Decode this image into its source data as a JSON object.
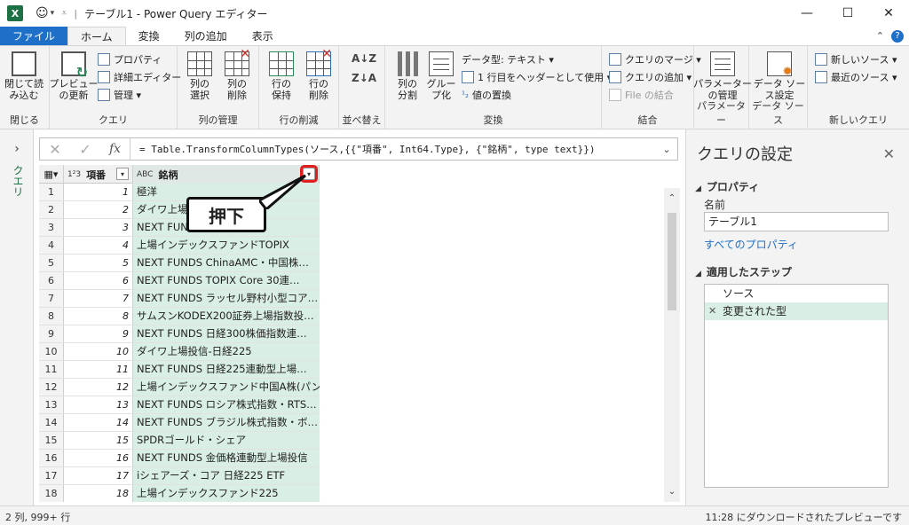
{
  "window": {
    "title": "テーブル1 - Power Query エディター",
    "app_icon": "X",
    "quick_access_icon": "smiley-icon"
  },
  "tabs": [
    {
      "label": "ファイル"
    },
    {
      "label": "ホーム"
    },
    {
      "label": "変換"
    },
    {
      "label": "列の追加"
    },
    {
      "label": "表示"
    }
  ],
  "ribbon": {
    "close": {
      "btn": "閉じて読\nみ込む",
      "group": "閉じる"
    },
    "query": {
      "preview": "プレビュー\nの更新",
      "properties": "プロパティ",
      "advanced_editor": "詳細エディター",
      "manage": "管理",
      "group": "クエリ"
    },
    "columns": {
      "choose": "列の\n選択",
      "remove": "列の\n削除",
      "group": "列の管理"
    },
    "rows": {
      "keep": "行の\n保持",
      "remove": "行の\n削除",
      "group": "行の削減"
    },
    "sort": {
      "group": "並べ替え",
      "az": "A↓Z",
      "za": "Z↓A"
    },
    "transform": {
      "split": "列の\n分割",
      "group_by": "グルー\nプ化",
      "data_type": "データ型: テキスト",
      "header": "1 行目をヘッダーとして使用",
      "replace": "値の置換",
      "group": "変換"
    },
    "combine": {
      "merge": "クエリのマージ",
      "append": "クエリの追加",
      "file_combine": "File の結合",
      "group": "結合"
    },
    "params": {
      "manage": "パラメーター\nの管理",
      "group": "パラメーター"
    },
    "datasource": {
      "settings": "データ ソー\nス設定",
      "group": "データ ソース"
    },
    "newquery": {
      "new_source": "新しいソース",
      "recent": "最近のソース",
      "group": "新しいクエリ"
    }
  },
  "left_pane": {
    "label": "クエリ"
  },
  "formula": {
    "text": "= Table.TransformColumnTypes(ソース,{{\"項番\", Int64.Type}, {\"銘柄\", type text}})"
  },
  "grid": {
    "col1": {
      "type": "1²3",
      "name": "項番"
    },
    "col2": {
      "type": "ABC",
      "name": "銘柄"
    },
    "rows": [
      {
        "n": "1",
        "id": "1",
        "name": "極洋"
      },
      {
        "n": "2",
        "id": "2",
        "name": "ダイワ上場"
      },
      {
        "n": "3",
        "id": "3",
        "name": "NEXT FUNDS 型上場投…"
      },
      {
        "n": "4",
        "id": "4",
        "name": "上場インデックスファンドTOPIX"
      },
      {
        "n": "5",
        "id": "5",
        "name": "NEXT FUNDS ChinaAMC・中国株…"
      },
      {
        "n": "6",
        "id": "6",
        "name": "NEXT FUNDS TOPIX Core 30連…"
      },
      {
        "n": "7",
        "id": "7",
        "name": "NEXT FUNDS ラッセル野村小型コア…"
      },
      {
        "n": "8",
        "id": "8",
        "name": "サムスンKODEX200証券上場指数投…"
      },
      {
        "n": "9",
        "id": "9",
        "name": "NEXT FUNDS 日経300株価指数連…"
      },
      {
        "n": "10",
        "id": "10",
        "name": "ダイワ上場投信-日経225"
      },
      {
        "n": "11",
        "id": "11",
        "name": "NEXT FUNDS 日経225連動型上場…"
      },
      {
        "n": "12",
        "id": "12",
        "name": "上場インデックスファンド中国A株(パン…"
      },
      {
        "n": "13",
        "id": "13",
        "name": "NEXT FUNDS ロシア株式指数・RTS…"
      },
      {
        "n": "14",
        "id": "14",
        "name": "NEXT FUNDS ブラジル株式指数・ボ…"
      },
      {
        "n": "15",
        "id": "15",
        "name": "SPDRゴールド・シェア"
      },
      {
        "n": "16",
        "id": "16",
        "name": "NEXT FUNDS 金価格連動型上場投信"
      },
      {
        "n": "17",
        "id": "17",
        "name": "iシェアーズ・コア 日経225 ETF"
      },
      {
        "n": "18",
        "id": "18",
        "name": "上場インデックスファンド225"
      }
    ]
  },
  "callout": {
    "text": "押下"
  },
  "settings": {
    "title": "クエリの設定",
    "properties": "プロパティ",
    "name_label": "名前",
    "name_value": "テーブル1",
    "all_props": "すべてのプロパティ",
    "applied_steps": "適用したステップ",
    "steps": [
      {
        "label": "ソース",
        "selected": false
      },
      {
        "label": "変更された型",
        "selected": true
      }
    ]
  },
  "status": {
    "left": "2 列, 999+ 行",
    "right": "11:28 にダウンロードされたプレビューです"
  }
}
